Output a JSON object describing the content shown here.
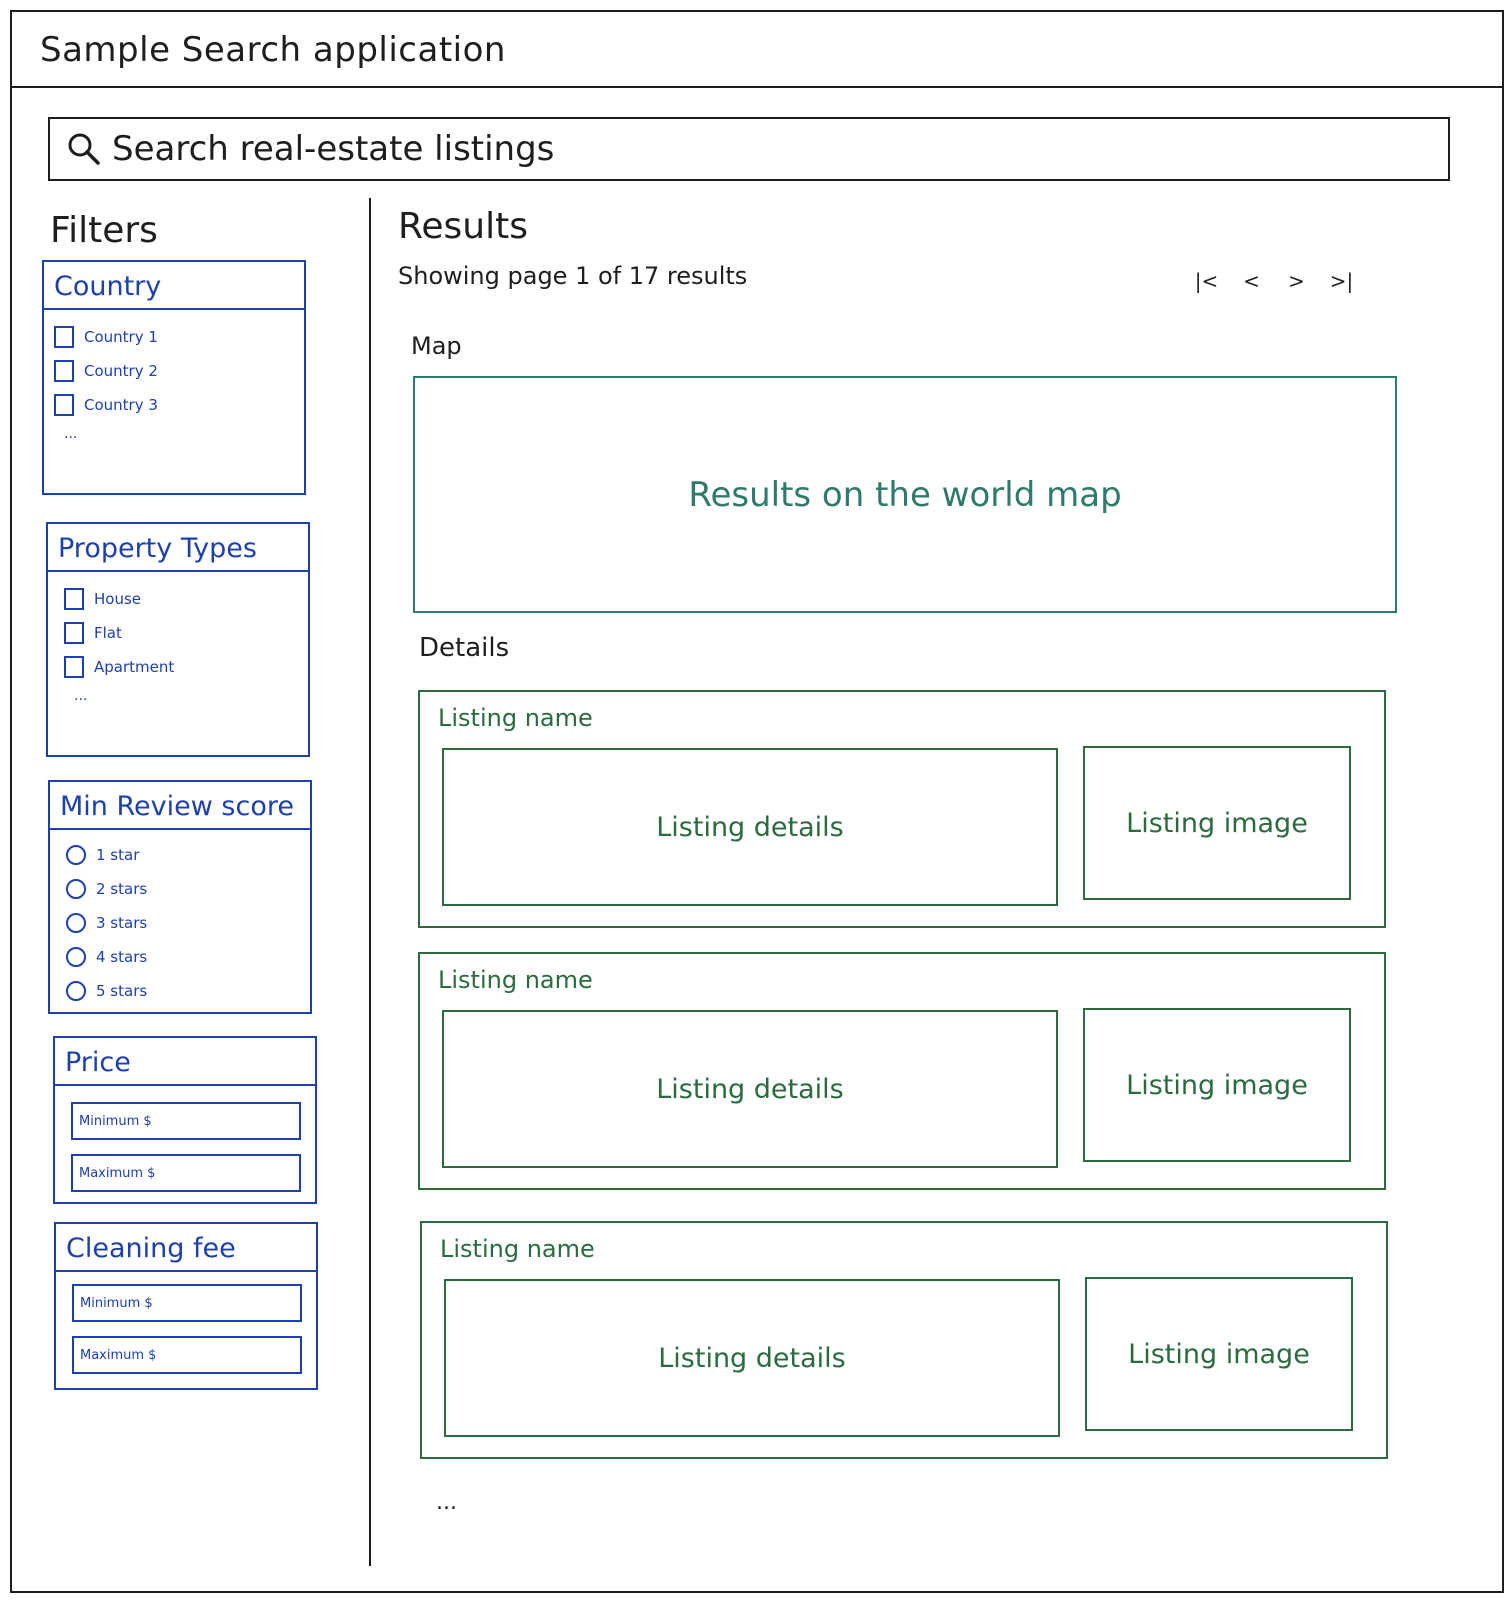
{
  "app": {
    "title": "Sample Search application"
  },
  "search": {
    "placeholder": "Search real-estate listings"
  },
  "filters": {
    "title": "Filters",
    "country": {
      "title": "Country",
      "items": [
        "Country 1",
        "Country 2",
        "Country 3"
      ],
      "more": "..."
    },
    "property_types": {
      "title": "Property Types",
      "items": [
        "House",
        "Flat",
        "Apartment"
      ],
      "more": "..."
    },
    "min_review_score": {
      "title": "Min Review score",
      "items": [
        "1 star",
        "2 stars",
        "3 stars",
        "4 stars",
        "5 stars"
      ]
    },
    "price": {
      "title": "Price",
      "min_placeholder": "Minimum $",
      "max_placeholder": "Maximum $"
    },
    "cleaning_fee": {
      "title": "Cleaning fee",
      "min_placeholder": "Minimum $",
      "max_placeholder": "Maximum $"
    }
  },
  "results": {
    "title": "Results",
    "showing": "Showing page 1 of 17 results",
    "pager": {
      "first": "|<",
      "prev": "<",
      "next": ">",
      "last": ">|"
    },
    "map_label": "Map",
    "map_text": "Results on the world map",
    "details_label": "Details",
    "listings": [
      {
        "name": "Listing name",
        "details": "Listing details",
        "image": "Listing image"
      },
      {
        "name": "Listing name",
        "details": "Listing details",
        "image": "Listing image"
      },
      {
        "name": "Listing name",
        "details": "Listing details",
        "image": "Listing image"
      }
    ],
    "more": "..."
  },
  "colors": {
    "ink": "#1e1e1e",
    "filters": "#1e40af",
    "map": "#2f7a6b",
    "listing": "#2b6b3f"
  }
}
